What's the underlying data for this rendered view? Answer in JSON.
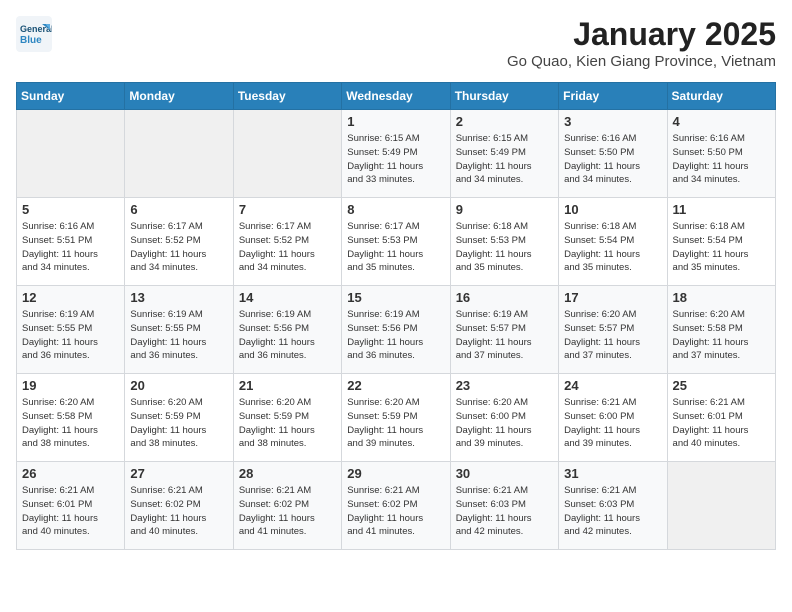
{
  "header": {
    "logo_line1": "General",
    "logo_line2": "Blue",
    "title": "January 2025",
    "subtitle": "Go Quao, Kien Giang Province, Vietnam"
  },
  "weekdays": [
    "Sunday",
    "Monday",
    "Tuesday",
    "Wednesday",
    "Thursday",
    "Friday",
    "Saturday"
  ],
  "weeks": [
    [
      {
        "day": "",
        "info": ""
      },
      {
        "day": "",
        "info": ""
      },
      {
        "day": "",
        "info": ""
      },
      {
        "day": "1",
        "info": "Sunrise: 6:15 AM\nSunset: 5:49 PM\nDaylight: 11 hours\nand 33 minutes."
      },
      {
        "day": "2",
        "info": "Sunrise: 6:15 AM\nSunset: 5:49 PM\nDaylight: 11 hours\nand 34 minutes."
      },
      {
        "day": "3",
        "info": "Sunrise: 6:16 AM\nSunset: 5:50 PM\nDaylight: 11 hours\nand 34 minutes."
      },
      {
        "day": "4",
        "info": "Sunrise: 6:16 AM\nSunset: 5:50 PM\nDaylight: 11 hours\nand 34 minutes."
      }
    ],
    [
      {
        "day": "5",
        "info": "Sunrise: 6:16 AM\nSunset: 5:51 PM\nDaylight: 11 hours\nand 34 minutes."
      },
      {
        "day": "6",
        "info": "Sunrise: 6:17 AM\nSunset: 5:52 PM\nDaylight: 11 hours\nand 34 minutes."
      },
      {
        "day": "7",
        "info": "Sunrise: 6:17 AM\nSunset: 5:52 PM\nDaylight: 11 hours\nand 34 minutes."
      },
      {
        "day": "8",
        "info": "Sunrise: 6:17 AM\nSunset: 5:53 PM\nDaylight: 11 hours\nand 35 minutes."
      },
      {
        "day": "9",
        "info": "Sunrise: 6:18 AM\nSunset: 5:53 PM\nDaylight: 11 hours\nand 35 minutes."
      },
      {
        "day": "10",
        "info": "Sunrise: 6:18 AM\nSunset: 5:54 PM\nDaylight: 11 hours\nand 35 minutes."
      },
      {
        "day": "11",
        "info": "Sunrise: 6:18 AM\nSunset: 5:54 PM\nDaylight: 11 hours\nand 35 minutes."
      }
    ],
    [
      {
        "day": "12",
        "info": "Sunrise: 6:19 AM\nSunset: 5:55 PM\nDaylight: 11 hours\nand 36 minutes."
      },
      {
        "day": "13",
        "info": "Sunrise: 6:19 AM\nSunset: 5:55 PM\nDaylight: 11 hours\nand 36 minutes."
      },
      {
        "day": "14",
        "info": "Sunrise: 6:19 AM\nSunset: 5:56 PM\nDaylight: 11 hours\nand 36 minutes."
      },
      {
        "day": "15",
        "info": "Sunrise: 6:19 AM\nSunset: 5:56 PM\nDaylight: 11 hours\nand 36 minutes."
      },
      {
        "day": "16",
        "info": "Sunrise: 6:19 AM\nSunset: 5:57 PM\nDaylight: 11 hours\nand 37 minutes."
      },
      {
        "day": "17",
        "info": "Sunrise: 6:20 AM\nSunset: 5:57 PM\nDaylight: 11 hours\nand 37 minutes."
      },
      {
        "day": "18",
        "info": "Sunrise: 6:20 AM\nSunset: 5:58 PM\nDaylight: 11 hours\nand 37 minutes."
      }
    ],
    [
      {
        "day": "19",
        "info": "Sunrise: 6:20 AM\nSunset: 5:58 PM\nDaylight: 11 hours\nand 38 minutes."
      },
      {
        "day": "20",
        "info": "Sunrise: 6:20 AM\nSunset: 5:59 PM\nDaylight: 11 hours\nand 38 minutes."
      },
      {
        "day": "21",
        "info": "Sunrise: 6:20 AM\nSunset: 5:59 PM\nDaylight: 11 hours\nand 38 minutes."
      },
      {
        "day": "22",
        "info": "Sunrise: 6:20 AM\nSunset: 5:59 PM\nDaylight: 11 hours\nand 39 minutes."
      },
      {
        "day": "23",
        "info": "Sunrise: 6:20 AM\nSunset: 6:00 PM\nDaylight: 11 hours\nand 39 minutes."
      },
      {
        "day": "24",
        "info": "Sunrise: 6:21 AM\nSunset: 6:00 PM\nDaylight: 11 hours\nand 39 minutes."
      },
      {
        "day": "25",
        "info": "Sunrise: 6:21 AM\nSunset: 6:01 PM\nDaylight: 11 hours\nand 40 minutes."
      }
    ],
    [
      {
        "day": "26",
        "info": "Sunrise: 6:21 AM\nSunset: 6:01 PM\nDaylight: 11 hours\nand 40 minutes."
      },
      {
        "day": "27",
        "info": "Sunrise: 6:21 AM\nSunset: 6:02 PM\nDaylight: 11 hours\nand 40 minutes."
      },
      {
        "day": "28",
        "info": "Sunrise: 6:21 AM\nSunset: 6:02 PM\nDaylight: 11 hours\nand 41 minutes."
      },
      {
        "day": "29",
        "info": "Sunrise: 6:21 AM\nSunset: 6:02 PM\nDaylight: 11 hours\nand 41 minutes."
      },
      {
        "day": "30",
        "info": "Sunrise: 6:21 AM\nSunset: 6:03 PM\nDaylight: 11 hours\nand 42 minutes."
      },
      {
        "day": "31",
        "info": "Sunrise: 6:21 AM\nSunset: 6:03 PM\nDaylight: 11 hours\nand 42 minutes."
      },
      {
        "day": "",
        "info": ""
      }
    ]
  ]
}
